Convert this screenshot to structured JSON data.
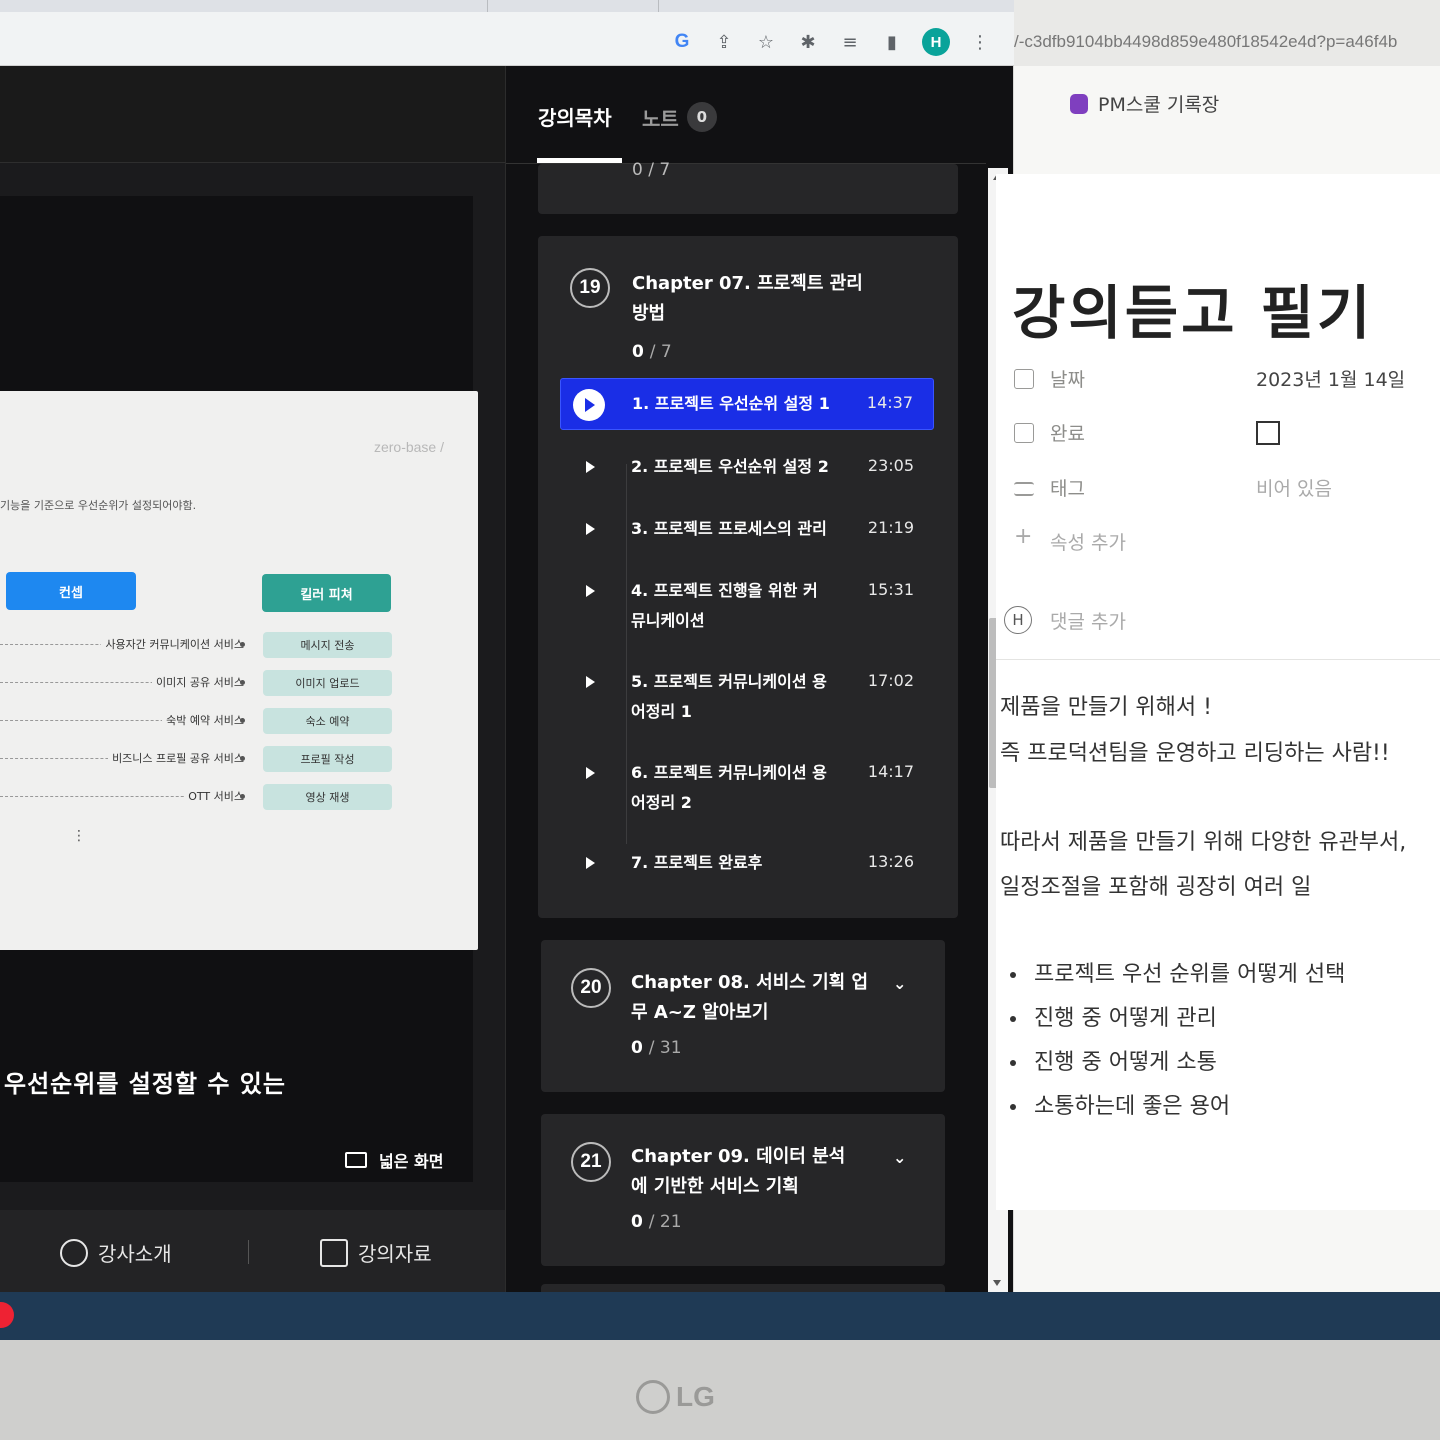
{
  "browser": {
    "profile_initial": "H",
    "icons": [
      "google-icon",
      "share-icon",
      "star-icon",
      "extensions-icon",
      "reading-list-icon",
      "side-panel-icon",
      "kebab-menu-icon"
    ]
  },
  "player": {
    "slide": {
      "brand": "zero-base /",
      "subtitle": "기능을 기준으로 우선순위가 설정되어야함.",
      "concept_label": "컨셉",
      "killer_label": "킬러 피쳐",
      "rows": [
        {
          "service": "사용자간 커뮤니케이션 서비스",
          "feature": "메시지 전송"
        },
        {
          "service": "이미지 공유 서비스",
          "feature": "이미지 업로드"
        },
        {
          "service": "숙박 예약 서비스",
          "feature": "숙소 예약"
        },
        {
          "service": "비즈니스 프로필 공유 서비스",
          "feature": "프로필 작성"
        },
        {
          "service": "OTT 서비스",
          "feature": "영상 재생"
        }
      ],
      "ellipsis": "⋮"
    },
    "caption": "우선순위를 설정할 수 있는",
    "wide_screen_label": "넓은 화면",
    "instructor_label": "강사소개",
    "materials_label": "강의자료"
  },
  "panel": {
    "tab_toc": "강의목차",
    "tab_note": "노트",
    "note_count": "0",
    "prev_progress": "0 / 7",
    "chapters": [
      {
        "number": "19",
        "title": "Chapter 07. 프로젝트 관리 방법",
        "progress_done": "0",
        "progress_total": "/ 7",
        "lessons": [
          {
            "title": "1. 프로젝트 우선순위 설정 1",
            "duration": "14:37"
          },
          {
            "title": "2. 프로젝트 우선순위 설정 2",
            "duration": "23:05"
          },
          {
            "title": "3. 프로젝트 프로세스의 관리",
            "duration": "21:19"
          },
          {
            "title": "4. 프로젝트 진행을 위한 커뮤니케이션",
            "duration": "15:31"
          },
          {
            "title": "5. 프로젝트 커뮤니케이션 용어정리 1",
            "duration": "17:02"
          },
          {
            "title": "6. 프로젝트 커뮤니케이션 용어정리 2",
            "duration": "14:17"
          },
          {
            "title": "7. 프로젝트 완료후",
            "duration": "13:26"
          }
        ]
      },
      {
        "number": "20",
        "title": "Chapter 08. 서비스 기획 업무 A~Z 알아보기",
        "progress_done": "0",
        "progress_total": "/ 31"
      },
      {
        "number": "21",
        "title": "Chapter 09. 데이터 분석에 기반한 서비스 기획",
        "progress_done": "0",
        "progress_total": "/ 21"
      }
    ],
    "active_color": "#1a2ee6"
  },
  "notes": {
    "url": "/-c3dfb9104bb4498d859e480f18542e4d?p=a46f4b",
    "breadcrumb": "PM스쿨 기록장",
    "title": "강의듣고 필기",
    "properties": {
      "date_label": "날짜",
      "date_value": "2023년 1월 14일",
      "done_label": "완료",
      "tag_label": "태그",
      "tag_value": "비어 있음",
      "add_property": "속성 추가"
    },
    "comment_avatar": "H",
    "add_comment": "댓글 추가",
    "paragraphs": [
      "제품을 만들기 위해서 !",
      "즉 프로덕션팀을 운영하고 리딩하는 사람!!",
      "따라서 제품을 만들기 위해 다양한 유관부서,",
      "일정조절을 포함해 굉장히 여러 일"
    ],
    "bullets": [
      "프로젝트 우선 순위를 어떻게 선택",
      "진행 중 어떻게 관리",
      "진행 중 어떻게 소통",
      "소통하는데 좋은 용어"
    ]
  },
  "monitor": {
    "brand": "LG"
  }
}
